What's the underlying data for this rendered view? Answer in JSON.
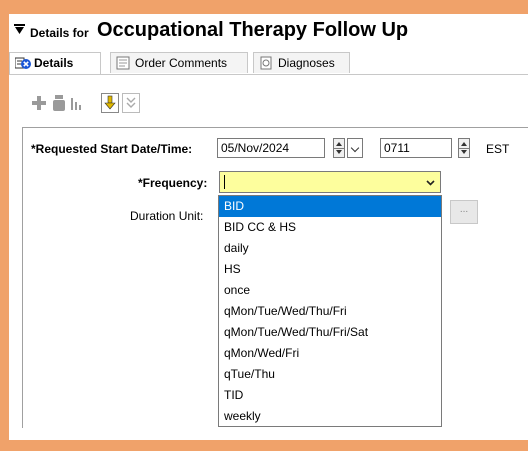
{
  "header": {
    "prefix": "Details for",
    "title": "Occupational Therapy Follow Up"
  },
  "tabs": [
    {
      "label": "Details"
    },
    {
      "label": "Order Comments"
    },
    {
      "label": "Diagnoses"
    }
  ],
  "form": {
    "start_label": "*Requested Start Date/Time:",
    "start_date": "05/Nov/2024",
    "start_time": "0711",
    "timezone": "EST",
    "frequency_label": "*Frequency:",
    "frequency_value": "",
    "duration_unit_label": "Duration Unit:",
    "ellipsis_label": "..."
  },
  "frequency_options": [
    "BID",
    "BID CC & HS",
    "daily",
    "HS",
    "once",
    "qMon/Tue/Wed/Thu/Fri",
    "qMon/Tue/Wed/Thu/Fri/Sat",
    "qMon/Wed/Fri",
    "qTue/Thu",
    "TID",
    "weekly"
  ],
  "colors": {
    "frame": "#f0a26a",
    "frequency_bg": "#fdfe9d",
    "selection": "#0078d7"
  }
}
